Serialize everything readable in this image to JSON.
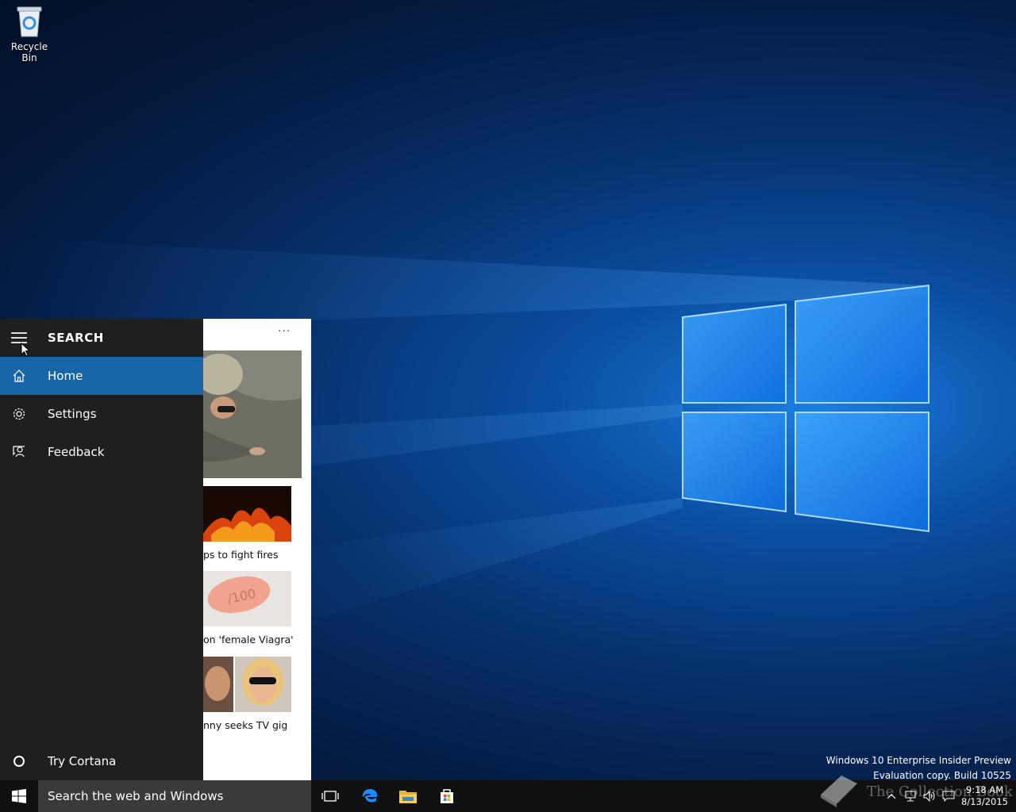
{
  "desktop": {
    "icons": [
      {
        "label": "Recycle Bin",
        "icon": "recycle-bin-icon"
      }
    ]
  },
  "cortana": {
    "title": "SEARCH",
    "nav": [
      {
        "label": "Home",
        "icon": "home-icon",
        "active": true
      },
      {
        "label": "Settings",
        "icon": "gear-icon",
        "active": false
      },
      {
        "label": "Feedback",
        "icon": "feedback-icon",
        "active": false
      }
    ],
    "try_cortana": "Try Cortana",
    "news": {
      "more": "···",
      "captions": [
        "ps to fight fires",
        "on 'female Viagra'",
        "nny seeks TV gig"
      ]
    }
  },
  "watermark": {
    "line1": "Windows 10 Enterprise Insider Preview",
    "line2": "Evaluation copy. Build 10525"
  },
  "taskbar": {
    "search_placeholder": "Search the web and Windows",
    "clock_time": "9:18 AM",
    "clock_date": "8/13/2015",
    "overlay_text": "The Collection Book"
  },
  "colors": {
    "accent": "#1565a7",
    "panel_bg": "#1f1f1f",
    "taskbar_bg": "#101010"
  }
}
